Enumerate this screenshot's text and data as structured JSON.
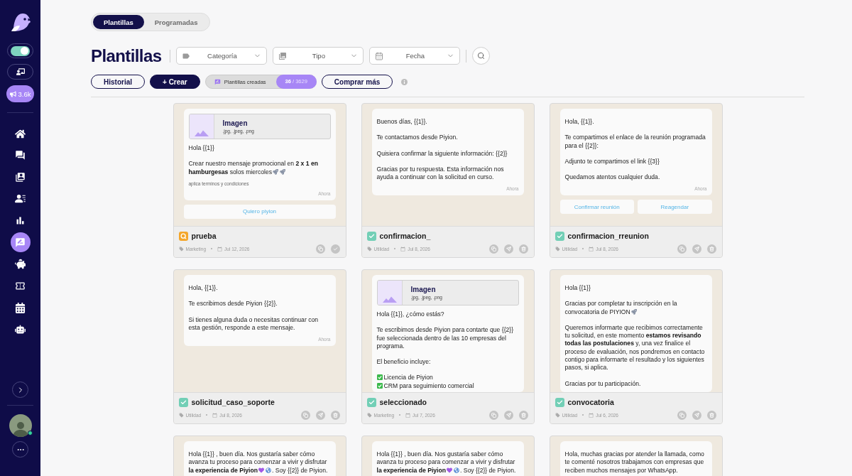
{
  "sidebar": {
    "toggle": {
      "on": true
    },
    "promo": {
      "label": "3.6k"
    },
    "nav": [
      {
        "kind": "home",
        "selected": false
      },
      {
        "kind": "chats",
        "selected": false
      },
      {
        "kind": "contacts",
        "selected": false
      },
      {
        "kind": "audience",
        "selected": false
      },
      {
        "kind": "reports",
        "selected": false
      },
      {
        "kind": "templates",
        "selected": true
      },
      {
        "kind": "savings",
        "selected": false
      },
      {
        "kind": "tickets",
        "selected": false
      },
      {
        "kind": "calendar",
        "selected": false
      },
      {
        "kind": "bot",
        "selected": false
      }
    ],
    "user": {
      "online": true
    }
  },
  "tabs": [
    {
      "label": "Plantillas",
      "selected": true
    },
    {
      "label": "Programadas",
      "selected": false
    }
  ],
  "title": "Plantillas",
  "filters": [
    {
      "kind": "category",
      "label": "Categoría"
    },
    {
      "kind": "type",
      "label": "Tipo"
    },
    {
      "kind": "date",
      "label": "Fecha"
    }
  ],
  "toolbar": [
    {
      "kind": "outline",
      "label": "Historial"
    },
    {
      "kind": "primary",
      "label": "+ Crear"
    },
    {
      "kind": "quota",
      "label": "Plantillas creadas",
      "count": "**36** / 3629"
    },
    {
      "kind": "outline",
      "label": "Comprar más"
    },
    {
      "kind": "info"
    }
  ],
  "templates": [
    {
      "name": "prueba",
      "approved": false,
      "category": "Marketing",
      "date": "Jul 12, 2026",
      "header": {
        "kind": "image",
        "title": "Imagen",
        "formats": ".jpg, .jpeg, .png"
      },
      "body": [
        {
          "kind": "paragraph",
          "text": "Hola {{1}}"
        },
        {
          "kind": "lines",
          "lines": [
            [
              {
                "kind": "text",
                "text": "Crear nuestro mensaje promocional en **2 x 1 en**"
              }
            ],
            [
              {
                "kind": "text",
                "text": "**hamburgesas** solos miercoles"
              },
              {
                "kind": "rocket"
              },
              {
                "kind": "rocket"
              }
            ]
          ]
        }
      ],
      "footer_text": "aplica terminos y condiciones",
      "time": "Ahora",
      "buttons": [
        "Quiero piyion"
      ],
      "actions": [
        {
          "kind": "copy"
        },
        {
          "kind": "check"
        }
      ]
    },
    {
      "name": "confirmacion_",
      "approved": true,
      "category": "Utilidad",
      "date": "Jul 8, 2026",
      "body": [
        {
          "kind": "paragraph",
          "text": "Buenos días, {{1}}."
        },
        {
          "kind": "paragraph",
          "text": "Te contactamos desde Piyion."
        },
        {
          "kind": "paragraph",
          "text": "Quisiera confirmar la siguiente información: {{2}}"
        },
        {
          "kind": "paragraph",
          "text": "Gracias por tu respuesta. Esta información nos ayuda a continuar con la solicitud en curso."
        }
      ],
      "time": "Ahora",
      "actions": [
        {
          "kind": "copy"
        },
        {
          "kind": "send"
        },
        {
          "kind": "delete"
        }
      ]
    },
    {
      "name": "confirmacion_rreunion",
      "approved": true,
      "category": "Utilidad",
      "date": "Jul 8, 2026",
      "body": [
        {
          "kind": "paragraph",
          "text": "Hola, {{1}}."
        },
        {
          "kind": "paragraph",
          "text": "Te compartimos el enlace de la reunión programada para el {{2}}:"
        },
        {
          "kind": "paragraph",
          "text": "Adjunto te compartimos el link {{3}}"
        },
        {
          "kind": "paragraph",
          "text": "Quedamos atentos cualquier duda."
        }
      ],
      "time": "Ahora",
      "buttons": [
        "Confirmar reunión",
        "Reagendar"
      ],
      "actions": [
        {
          "kind": "copy"
        },
        {
          "kind": "send"
        },
        {
          "kind": "delete"
        }
      ]
    },
    {
      "name": "solicitud_caso_soporte",
      "approved": true,
      "category": "Utilidad",
      "date": "Jul 8, 2026",
      "body": [
        {
          "kind": "paragraph",
          "text": "Hola, {{1}}."
        },
        {
          "kind": "paragraph",
          "text": "Te escribimos desde Piyion {{2}}."
        },
        {
          "kind": "paragraph",
          "text": "Si tienes alguna duda o necesitas continuar con esta gestión, responde a este mensaje."
        }
      ],
      "time": "Ahora",
      "actions": [
        {
          "kind": "copy"
        },
        {
          "kind": "send"
        },
        {
          "kind": "delete"
        }
      ]
    },
    {
      "name": "seleccionado",
      "approved": true,
      "category": "Marketing",
      "date": "Jul 7, 2026",
      "header": {
        "kind": "image",
        "title": "Imagen",
        "formats": ".jpg, .jpeg, .png"
      },
      "body": [
        {
          "kind": "paragraph",
          "text": "Hola {{1}}, ¿cómo estás?"
        },
        {
          "kind": "paragraph",
          "text": "Te escribimos desde Piyion para contarte que {{2}} fue seleccionada dentro de las 10 empresas del programa."
        },
        {
          "kind": "paragraph",
          "text": "El beneficio incluye:"
        },
        {
          "kind": "lines",
          "lines": [
            [
              {
                "kind": "checkmark"
              },
              {
                "kind": "text",
                "text": "Licencia de Piyion"
              }
            ],
            [
              {
                "kind": "checkmark"
              },
              {
                "kind": "text",
                "text": "CRM para seguimiento comercial"
              }
            ]
          ]
        }
      ],
      "actions": [
        {
          "kind": "copy"
        },
        {
          "kind": "send"
        },
        {
          "kind": "delete"
        }
      ]
    },
    {
      "name": "convocatoria",
      "approved": true,
      "category": "Utilidad",
      "date": "Jul 6, 2026",
      "body": [
        {
          "kind": "paragraph",
          "text": "Hola {{1}}"
        },
        {
          "kind": "lines",
          "lines": [
            [
              {
                "kind": "text",
                "text": "Gracias por completar tu inscripción en la"
              }
            ],
            [
              {
                "kind": "text",
                "text": "convocatoria de PIYION"
              },
              {
                "kind": "rocket"
              }
            ]
          ]
        },
        {
          "kind": "paragraph",
          "text": "Queremos informarte que recibimos correctamente tu solicitud, en este momento **estamos revisando todas las postulaciones** y, una vez finalice el proceso de evaluación, nos pondremos en contacto contigo para informarte el resultado y los siguientes pasos, si aplica."
        },
        {
          "kind": "paragraph",
          "text": "Gracias por tu participación."
        }
      ],
      "actions": [
        {
          "kind": "copy"
        },
        {
          "kind": "send"
        },
        {
          "kind": "delete"
        }
      ]
    },
    {
      "body": [
        {
          "kind": "lines",
          "lines": [
            [
              {
                "kind": "text",
                "text": "Hola {{1}} , buen día. Nos gustaría saber cómo"
              }
            ],
            [
              {
                "kind": "text",
                "text": "avanza tu proceso para comenzar a vivir y disfrutar"
              }
            ],
            [
              {
                "kind": "text",
                "text": "**la experiencia de Piyion**"
              },
              {
                "kind": "heart"
              },
              {
                "kind": "globe"
              },
              {
                "kind": "text",
                "text": ". Soy {{2}} de Piyion."
              }
            ]
          ]
        }
      ]
    },
    {
      "body": [
        {
          "kind": "lines",
          "lines": [
            [
              {
                "kind": "text",
                "text": "Hola {{1}} , buen día. Nos gustaría saber cómo"
              }
            ],
            [
              {
                "kind": "text",
                "text": "avanza tu proceso para comenzar a vivir y disfrutar"
              }
            ],
            [
              {
                "kind": "text",
                "text": "**la experiencia de Piyion**"
              },
              {
                "kind": "heart"
              },
              {
                "kind": "globe"
              },
              {
                "kind": "text",
                "text": ". Soy {{2}} de Piyion."
              }
            ]
          ]
        }
      ]
    },
    {
      "body": [
        {
          "kind": "paragraph",
          "text": "Hola, muchas gracias por atender la llamada, como te comenté nosotros trabajamos con empresas que reciben muchos mensajes por WhatsApp."
        }
      ]
    }
  ]
}
